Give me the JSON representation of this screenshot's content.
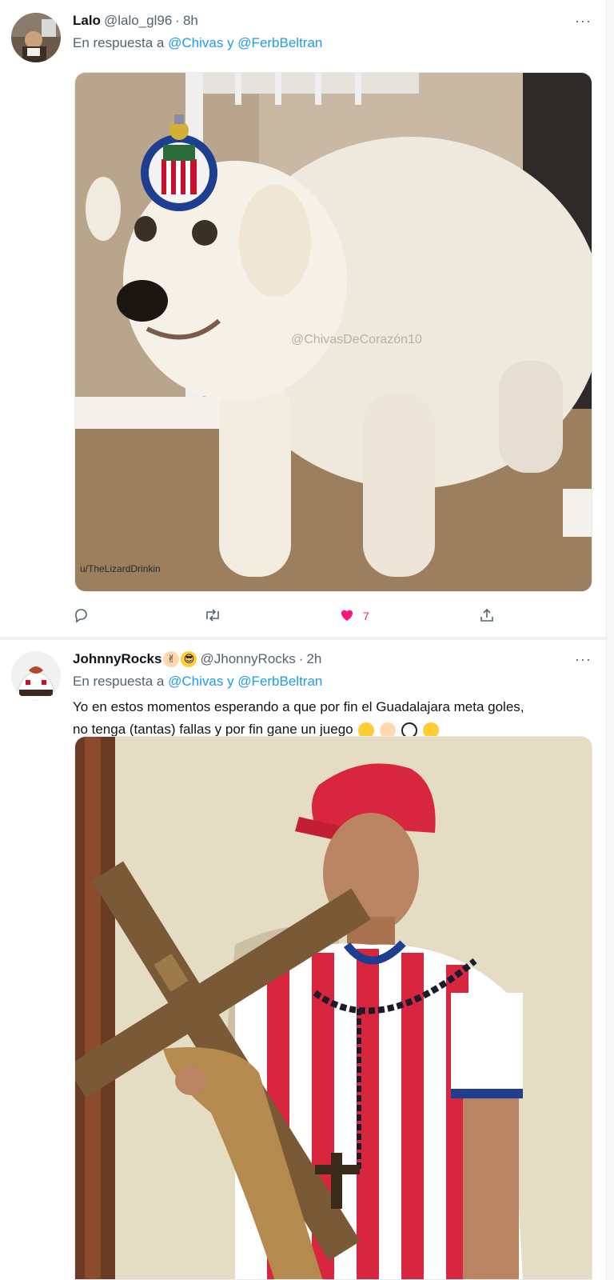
{
  "tweets": [
    {
      "name": "Lalo",
      "handle": "@lalo_gl96",
      "separator": "·",
      "time": "8h",
      "reply_prefix": "En respuesta a",
      "mention_1": "@Chivas",
      "reply_joiner": "y",
      "mention_2": "@FerbBeltran",
      "image_watermark": "@ChivasDeCorazón10",
      "image_credit": "u/TheLizardDrinkin",
      "like_count": "7",
      "more_label": "···"
    },
    {
      "name": "JohnnyRocks",
      "name_emojis": [
        "rock-hand-emoji",
        "sunglasses-emoji"
      ],
      "handle": "@JhonnyRocks",
      "separator": "·",
      "time": "2h",
      "reply_prefix": "En respuesta a",
      "mention_1": "@Chivas",
      "reply_joiner": "y",
      "mention_2": "@FerbBeltran",
      "text_line_1": "Yo en estos momentos esperando a que por fin el Guadalajara meta goles,",
      "text_line_2": "no tenga (tantas) fallas y por fin gane un juego",
      "text_emojis": [
        "relieved-face-emoji",
        "ok-hand-emoji",
        "soccer-ball-emoji",
        "laughing-face-emoji"
      ],
      "more_label": "···"
    }
  ],
  "colors": {
    "accent": "#1d9bf0",
    "like": "#f91880",
    "secondary_text": "#536471",
    "cap_red": "#d7263d"
  }
}
